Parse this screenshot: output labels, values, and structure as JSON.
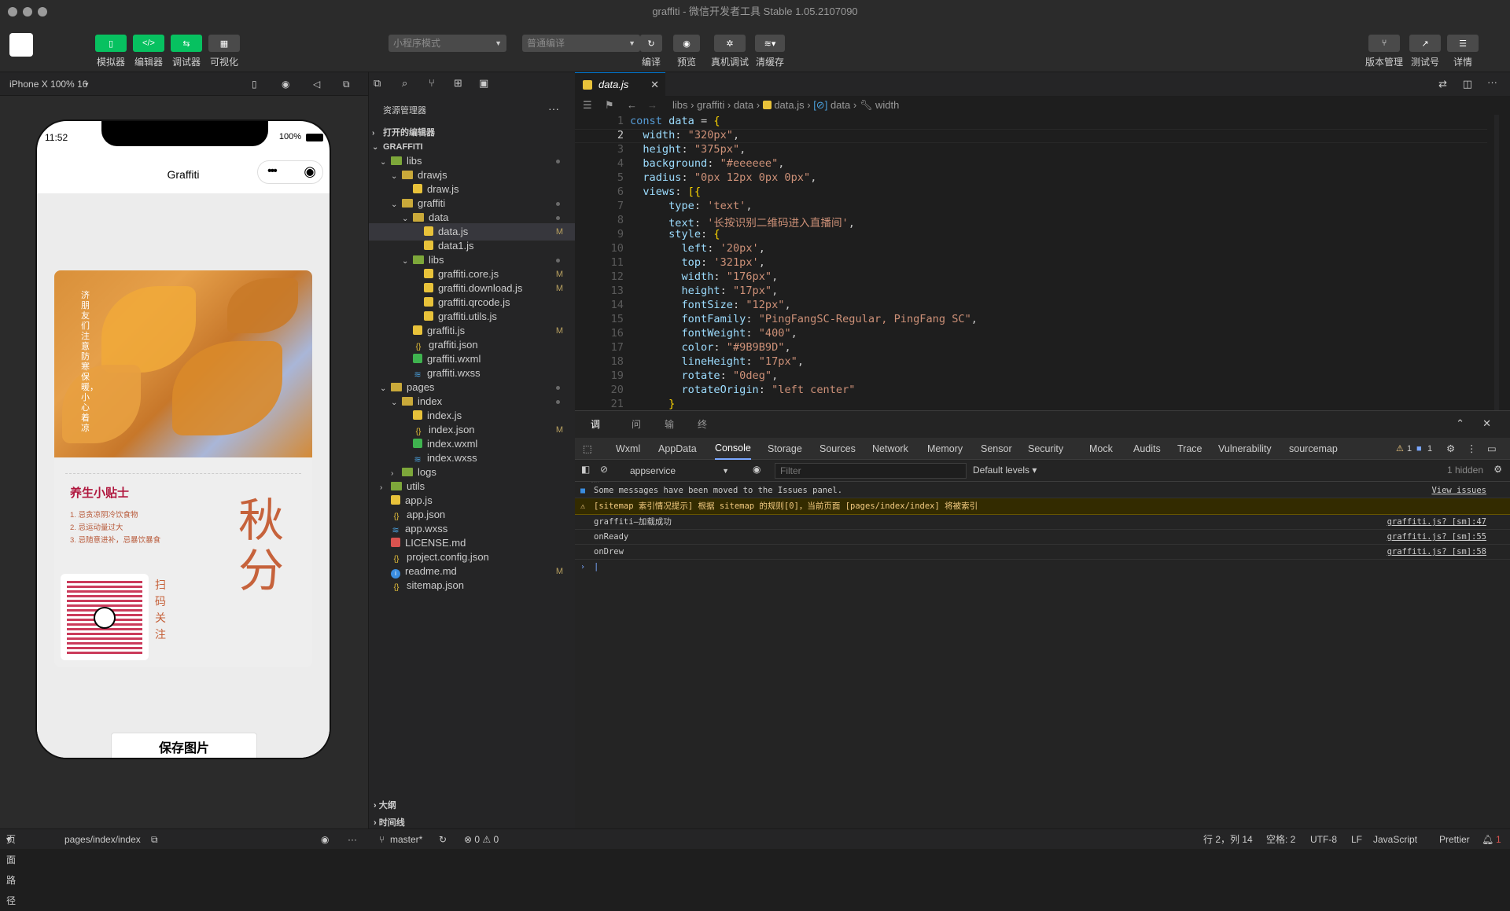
{
  "window": {
    "title": "graffiti - 微信开发者工具 Stable 1.05.2107090"
  },
  "toolbar": {
    "simulator": "模拟器",
    "editor": "编辑器",
    "debugger": "调试器",
    "visual": "可视化",
    "mode_select": "小程序模式",
    "compile_select": "普通编译",
    "compile": "编译",
    "preview": "预览",
    "real_debug": "真机调试",
    "clear_cache": "清缓存",
    "version": "版本管理",
    "test": "测试号",
    "details": "详情"
  },
  "simulator": {
    "device": "iPhone X 100% 16",
    "time": "11:52",
    "battery": "100%",
    "nav_title": "Graffiti",
    "vertical_text": "济朋友们注意防寒保暖，小心着凉",
    "tip_title": "养生小贴士",
    "tips": [
      "1. 忌贪凉阴冷饮食物",
      "2. 忌运动量过大",
      "3. 忌随意进补，忌暴饮暴食"
    ],
    "big_text": "秋分",
    "qr_text": "扫码关注",
    "save_button": "保存图片"
  },
  "explorer": {
    "title": "资源管理器",
    "open_editors": "打开的编辑器",
    "project": "GRAFFITI",
    "items": [
      {
        "label": "libs",
        "icon": "folder-icon"
      },
      {
        "label": "drawjs",
        "icon": "folder-icon"
      },
      {
        "label": "draw.js",
        "icon": "js-icon"
      },
      {
        "label": "graffiti",
        "icon": "folder-icon"
      },
      {
        "label": "data",
        "icon": "folder-icon"
      },
      {
        "label": "data.js",
        "icon": "js-icon",
        "badge": "M"
      },
      {
        "label": "data1.js",
        "icon": "js-icon"
      },
      {
        "label": "libs",
        "icon": "folder-icon"
      },
      {
        "label": "graffiti.core.js",
        "icon": "js-icon",
        "badge": "M"
      },
      {
        "label": "graffiti.download.js",
        "icon": "js-icon",
        "badge": "M"
      },
      {
        "label": "graffiti.qrcode.js",
        "icon": "js-icon"
      },
      {
        "label": "graffiti.utils.js",
        "icon": "js-icon"
      },
      {
        "label": "graffiti.js",
        "icon": "js-icon",
        "badge": "M"
      },
      {
        "label": "graffiti.json",
        "icon": "json-icon"
      },
      {
        "label": "graffiti.wxml",
        "icon": "wxml-icon"
      },
      {
        "label": "graffiti.wxss",
        "icon": "wxss-icon"
      },
      {
        "label": "pages",
        "icon": "folder-icon"
      },
      {
        "label": "index",
        "icon": "folder-icon"
      },
      {
        "label": "index.js",
        "icon": "js-icon"
      },
      {
        "label": "index.json",
        "icon": "json-icon",
        "badge": "M"
      },
      {
        "label": "index.wxml",
        "icon": "wxml-icon"
      },
      {
        "label": "index.wxss",
        "icon": "wxss-icon"
      },
      {
        "label": "logs",
        "icon": "folder-icon"
      },
      {
        "label": "utils",
        "icon": "folder-icon"
      },
      {
        "label": "app.js",
        "icon": "js-icon"
      },
      {
        "label": "app.json",
        "icon": "json-icon"
      },
      {
        "label": "app.wxss",
        "icon": "wxss-icon"
      },
      {
        "label": "LICENSE.md",
        "icon": "md-icon"
      },
      {
        "label": "project.config.json",
        "icon": "json-icon"
      },
      {
        "label": "readme.md",
        "icon": "info-icon",
        "badge": "M"
      },
      {
        "label": "sitemap.json",
        "icon": "json-icon"
      }
    ],
    "outline": "大纲",
    "timeline": "时间线"
  },
  "editor": {
    "tab": "data.js",
    "breadcrumb": [
      "libs",
      "graffiti",
      "data",
      "data.js",
      "data",
      "width"
    ],
    "line_numbers": [
      "1",
      "2",
      "3",
      "4",
      "5",
      "6",
      "7",
      "8",
      "9",
      "10",
      "11",
      "12",
      "13",
      "14",
      "15",
      "16",
      "17",
      "18",
      "19",
      "20",
      "21"
    ],
    "lines": [
      "const data = {",
      "  width: \"320px\",",
      "  height: \"375px\",",
      "  background: \"#eeeeee\",",
      "  radius: \"0px 12px 0px 0px\",",
      "  views: [{",
      "      type: 'text',",
      "      text: '长按识别二维码进入直播间',",
      "      style: {",
      "        left: '20px',",
      "        top: '321px',",
      "        width: \"176px\",",
      "        height: \"17px\",",
      "        fontSize: \"12px\",",
      "        fontFamily: \"PingFangSC-Regular, PingFang SC\",",
      "        fontWeight: \"400\",",
      "        color: \"#9B9B9D\",",
      "        lineHeight: \"17px\",",
      "        rotate: \"0deg\",",
      "        rotateOrigin: \"left center\"",
      "      }"
    ]
  },
  "panel": {
    "tabs": [
      "调试器",
      "问题",
      "输出",
      "终端"
    ],
    "devtabs": [
      "Wxml",
      "AppData",
      "Console",
      "Storage",
      "Sources",
      "Network",
      "Memory",
      "Sensor",
      "Security",
      "Mock",
      "Audits",
      "Trace",
      "Vulnerability",
      "sourcemap"
    ],
    "warn_count": "1",
    "info_count": "1",
    "context": "appservice",
    "filter_placeholder": "Filter",
    "levels": "Default levels",
    "hidden": "1 hidden",
    "messages": [
      {
        "text": "Some messages have been moved to the Issues panel.",
        "src": "View issues"
      },
      {
        "text": "[sitemap 索引情况提示] 根据 sitemap 的规则[0]，当前页面 [pages/index/index] 将被索引",
        "src": ""
      },
      {
        "text": "graffiti—加载成功",
        "src": "graffiti.js? [sm]:47"
      },
      {
        "text": "onReady",
        "src": "graffiti.js? [sm]:55"
      },
      {
        "text": "onDrew",
        "src": "graffiti.js? [sm]:58"
      }
    ]
  },
  "statusbar": {
    "page_path_label": "页面路径",
    "page_path": "pages/index/index",
    "branch": "master*",
    "problems": "⊗ 0 ⚠ 0",
    "cursor": "行 2，列 14",
    "spaces": "空格: 2",
    "encoding": "UTF-8",
    "eol": "LF",
    "language": "JavaScript",
    "formatter": "Prettier",
    "bell": "1"
  }
}
